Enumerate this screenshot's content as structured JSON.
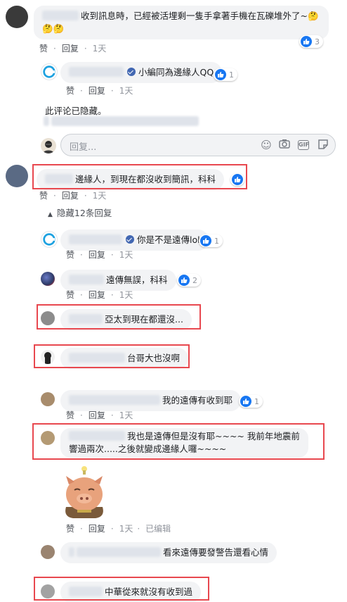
{
  "comments": {
    "c1": {
      "text": "收到訊息時，已經被活埋剩一隻手拿著手機在瓦礫堆外了~",
      "emoji": "🤔🤔🤔",
      "like_label": "赞",
      "reply_label": "回复",
      "time": "1天",
      "reactions": "3"
    },
    "r1": {
      "text": "小編同為邊緣人QQ",
      "like_label": "赞",
      "reply_label": "回复",
      "time": "1天",
      "reactions": "1"
    },
    "hidden_notice": "此评论已隐藏。",
    "reply_input": {
      "placeholder": "回复..."
    },
    "c2": {
      "text": "邊緣人，到現在都沒收到簡訊，科科",
      "like_label": "赞",
      "reply_label": "回复",
      "time": "1天"
    },
    "hide_replies": "隐藏12条回复",
    "r2": {
      "text": "你是不是遠傳lol",
      "like_label": "赞",
      "reply_label": "回复",
      "time": "1天",
      "reactions": "1"
    },
    "r3": {
      "text": "遠傳無誤，科科",
      "like_label": "赞",
      "reply_label": "回复",
      "time": "1天",
      "reactions": "2"
    },
    "r4": {
      "text": "亞太到現在都還沒..."
    },
    "r5": {
      "text": "台哥大也沒啊"
    },
    "r6": {
      "text": "我的遠傳有收到耶",
      "like_label": "赞",
      "reply_label": "回复",
      "time": "1天",
      "reactions": "1"
    },
    "r7": {
      "text_line1": "我也是遠傳但是沒有耶~~~~ 我前年地震前",
      "text_line2": "響過兩次.....之後就變成邊緣人囉~~~~"
    },
    "r8": {
      "like_label": "赞",
      "reply_label": "回复",
      "time": "1天",
      "edited": "已编辑"
    },
    "r9": {
      "text": "看來遠傳要發警告還看心情"
    },
    "r10": {
      "text": "中華從來就沒有收到過"
    }
  },
  "colors": {
    "accent": "#4267b2",
    "highlight": "#e8484f",
    "bubble": "#f2f3f5"
  }
}
